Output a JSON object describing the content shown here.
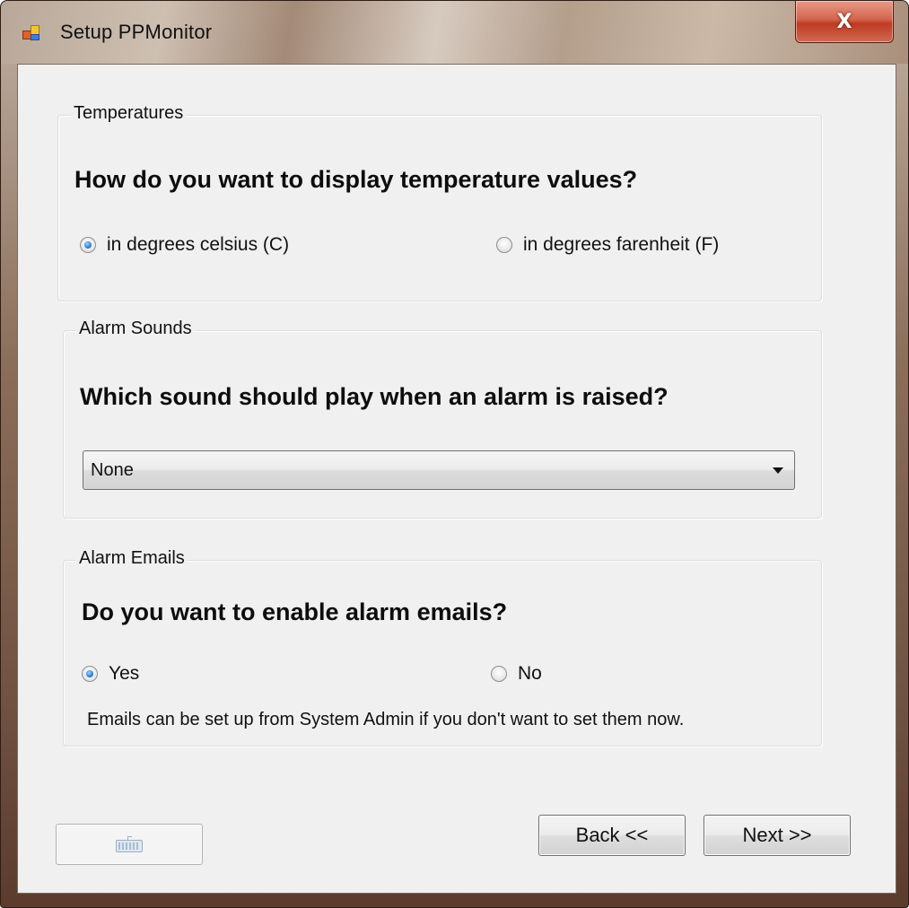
{
  "window": {
    "title": "Setup PPMonitor",
    "close_label": "X"
  },
  "temperatures": {
    "group_title": "Temperatures",
    "question": "How do you want to display temperature values?",
    "options": [
      {
        "label": "in degrees celsius (C)",
        "checked": true
      },
      {
        "label": "in degrees farenheit (F)",
        "checked": false
      }
    ]
  },
  "alarm_sounds": {
    "group_title": "Alarm Sounds",
    "question": "Which sound should play when an alarm is raised?",
    "selected": "None"
  },
  "alarm_emails": {
    "group_title": "Alarm Emails",
    "question": "Do you want to enable alarm emails?",
    "options": [
      {
        "label": "Yes",
        "checked": true
      },
      {
        "label": "No",
        "checked": false
      }
    ],
    "note": "Emails can be set up from System Admin if you don't want to set them now."
  },
  "footer": {
    "keyboard_button_icon": "keyboard-icon",
    "back_label": "Back <<",
    "next_label": "Next >>"
  }
}
